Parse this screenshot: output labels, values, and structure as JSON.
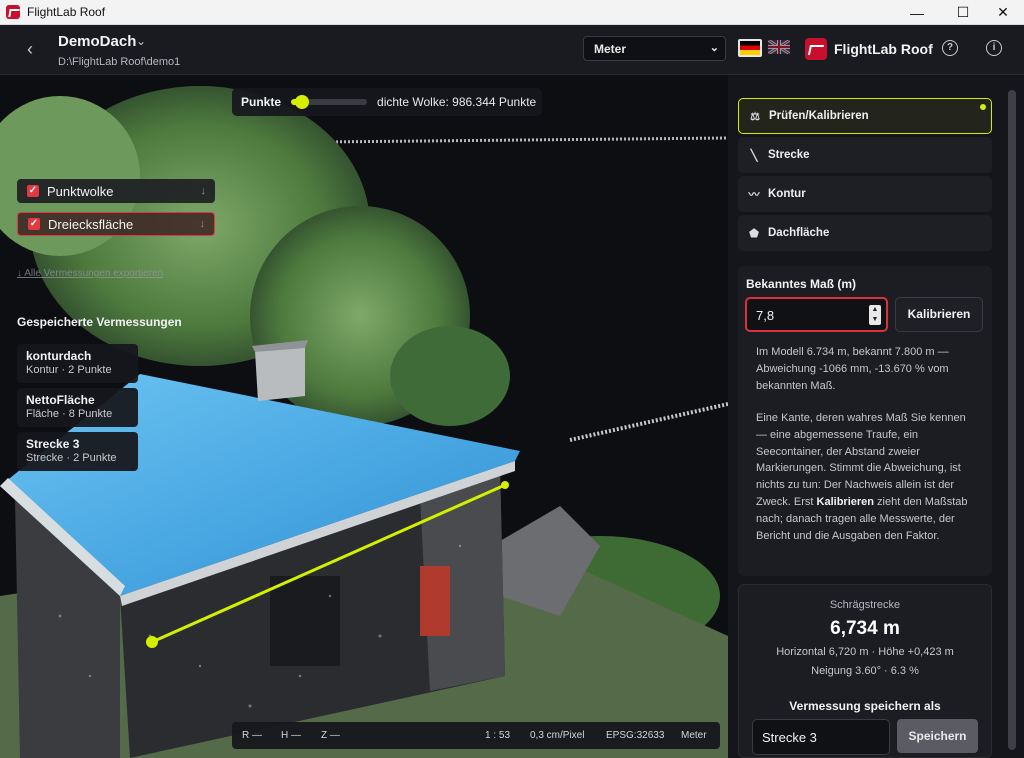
{
  "window": {
    "title": "FlightLab Roof",
    "controls": {
      "minimize": "—",
      "maximize": "☐",
      "close": "✕"
    }
  },
  "header": {
    "back_icon": "‹",
    "project_name": "DemoDach",
    "project_chevron": "⌄",
    "project_path": "D:\\FlightLab Roof\\demo1",
    "unit_select": "Meter",
    "unit_chevron": "⌄",
    "brand": "FlightLab Roof",
    "help_icon": "?",
    "info_icon": "i"
  },
  "viewport": {
    "points_label": "Punkte",
    "points_slider_fraction": 0.05,
    "density_text": "dichte Wolke: 986.344 Punkte",
    "layers": [
      {
        "label": "Punktwolke",
        "checked": true,
        "download_icon": "↓"
      },
      {
        "label": "Dreiecksfläche",
        "checked": true,
        "download_icon": "↓"
      }
    ],
    "all_measurements_link": "↓ Alle Vermessungen exportieren",
    "saved_title": "Gespeicherte Vermessungen",
    "saved": [
      {
        "name": "konturdach",
        "detail": "Kontur · 2 Punkte"
      },
      {
        "name": "NettoFläche",
        "detail": "Fläche · 8 Punkte"
      },
      {
        "name": "Strecke 3",
        "detail": "Strecke · 2 Punkte"
      }
    ],
    "status": {
      "r": "R —",
      "h": "H —",
      "z": "Z —",
      "scale": "1 : 53",
      "gsd": "0,3 cm/Pixel",
      "epsg": "EPSG:32633",
      "unit": "Meter"
    }
  },
  "tools": [
    {
      "label": "Prüfen/Kalibrieren",
      "icon": "⚖",
      "active": true
    },
    {
      "label": "Strecke",
      "icon": "╲",
      "active": false
    },
    {
      "label": "Kontur",
      "icon": "〰",
      "active": false
    },
    {
      "label": "Dachfläche",
      "icon": "⬟",
      "active": false
    }
  ],
  "calibration": {
    "heading": "Bekanntes Maß (m)",
    "input_value": "7,8",
    "calibrate_button": "Kalibrieren",
    "result_text": "Im Modell 6.734 m, bekannt 7.800 m — Abweichung -1066 mm, -13.670 % vom bekannten Maß.",
    "help_before": "Eine Kante, deren wahres Maß Sie kennen — eine abgemessene Traufe, ein Seecontainer, der Abstand zweier Markierungen. Stimmt die Abweichung, ist nichts zu tun: Der Nachweis allein ist der Zweck. Erst ",
    "help_bold": "Kalibrieren",
    "help_after": " zieht den Maßstab nach; danach tragen alle Messwerte, der Bericht und die Ausgaben den Faktor."
  },
  "measurement": {
    "caption": "Schrägstrecke",
    "value": "6,734 m",
    "line1": "Horizontal 6,720 m · Höhe +0,423 m",
    "line2": "Neigung 3.60° · 6.3 %",
    "save_label": "Vermessung speichern als",
    "name_value": "Strecke 3",
    "save_button": "Speichern"
  },
  "colors": {
    "accent": "#d4f000",
    "danger": "#e2383f",
    "panel": "#15161b",
    "roof_blue": "#3aa6e6"
  }
}
